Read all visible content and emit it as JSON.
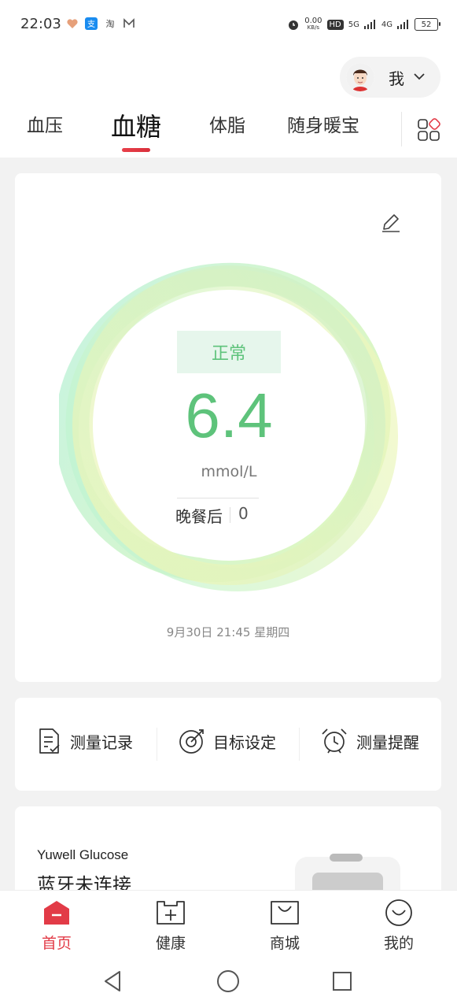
{
  "status_bar": {
    "time": "22:03",
    "net_speed": "0.00",
    "net_unit": "KB/s",
    "hd": "HD",
    "sig1": "5G",
    "sig2": "4G",
    "battery": "52"
  },
  "header": {
    "user_name": "我",
    "tabs": [
      {
        "label": "血压"
      },
      {
        "label": "血糖"
      },
      {
        "label": "体脂"
      },
      {
        "label": "随身暖宝"
      }
    ]
  },
  "reading": {
    "status": "正常",
    "value": "6.4",
    "unit": "mmol/L",
    "meal": "晚餐后",
    "meal_value": "0",
    "time": "9月30日 21:45 星期四",
    "colors": {
      "normal": "#5ec37b",
      "accent": "#e23b47"
    }
  },
  "actions": [
    {
      "label": "测量记录",
      "icon": "record-icon"
    },
    {
      "label": "目标设定",
      "icon": "target-icon"
    },
    {
      "label": "测量提醒",
      "icon": "alarm-icon"
    }
  ],
  "device": {
    "name": "Yuwell Glucose",
    "status": "蓝牙未连接"
  },
  "bottom_nav": [
    {
      "label": "首页",
      "icon": "home-icon"
    },
    {
      "label": "健康",
      "icon": "health-icon"
    },
    {
      "label": "商城",
      "icon": "shop-icon"
    },
    {
      "label": "我的",
      "icon": "profile-icon"
    }
  ]
}
